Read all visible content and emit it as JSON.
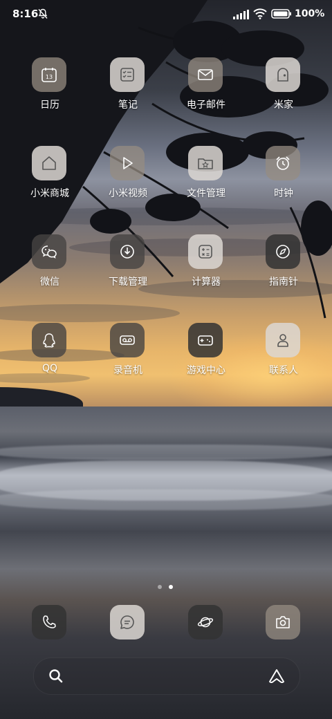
{
  "status_bar": {
    "time": "8:16",
    "battery": "100%",
    "icons": [
      "bell-muted-icon",
      "signal-icon",
      "wifi-icon",
      "battery-icon"
    ]
  },
  "apps": [
    {
      "label": "日历",
      "icon": "calendar-icon"
    },
    {
      "label": "笔记",
      "icon": "notes-icon"
    },
    {
      "label": "电子邮件",
      "icon": "mail-icon"
    },
    {
      "label": "米家",
      "icon": "mi-home-icon"
    },
    {
      "label": "小米商城",
      "icon": "home-store-icon"
    },
    {
      "label": "小米视频",
      "icon": "play-icon"
    },
    {
      "label": "文件管理",
      "icon": "folder-icon"
    },
    {
      "label": "时钟",
      "icon": "alarm-clock-icon"
    },
    {
      "label": "微信",
      "icon": "wechat-icon"
    },
    {
      "label": "下载管理",
      "icon": "download-icon"
    },
    {
      "label": "计算器",
      "icon": "calculator-icon"
    },
    {
      "label": "指南针",
      "icon": "compass-icon"
    },
    {
      "label": "QQ",
      "icon": "qq-icon"
    },
    {
      "label": "录音机",
      "icon": "recorder-icon"
    },
    {
      "label": "游戏中心",
      "icon": "gamepad-icon"
    },
    {
      "label": "联系人",
      "icon": "contacts-icon"
    }
  ],
  "calendar_day": "13",
  "page_indicator": {
    "pages": 2,
    "current": 2
  },
  "dock": [
    {
      "icon": "phone-icon"
    },
    {
      "icon": "messages-icon"
    },
    {
      "icon": "planet-browser-icon"
    },
    {
      "icon": "camera-icon"
    }
  ],
  "search_bar": {
    "icons": [
      "search-icon",
      "assistant-icon"
    ]
  }
}
